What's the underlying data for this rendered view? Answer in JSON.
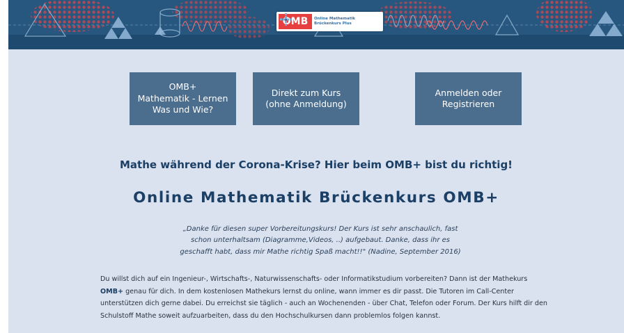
{
  "banner": {
    "logo_text": "OMB",
    "logo_sub1": "Online Mathematik",
    "logo_sub2": "Brückenkurs Plus"
  },
  "nav": {
    "buttons": [
      {
        "label": "OMB+\nMathematik - Lernen\nWas und Wie?"
      },
      {
        "label": "Direkt zum Kurs\n(ohne Anmeldung)"
      },
      {
        "label": "Anmelden oder\nRegistrieren"
      }
    ]
  },
  "main": {
    "headline": "Mathe während der Corona-Krise? Hier beim OMB+ bist du richtig!",
    "title": "Online Mathematik Brückenkurs OMB+",
    "quote": "„Danke für diesen super Vorbereitungskurs! Der Kurs ist sehr anschaulich, fast schon unterhaltsam (Diagramme,Videos, ..) aufgebaut. Danke, dass ihr es geschafft habt, dass mir Mathe richtig Spaß macht!!\" (Nadine, September 2016)",
    "intro_before": "Du willst dich auf ein Ingenieur-, Wirtschafts-, Naturwissenschafts- oder Informatikstudium vorbereiten? Dann ist der Mathekurs ",
    "intro_bold": "OMB+",
    "intro_after": " genau für dich. In dem kostenlosen Mathekurs lernst du online, wann immer es dir passt. Die Tutoren im Call-Center unterstützen dich gerne dabei. Du erreichst sie täglich - auch an Wochenenden - über Chat, Telefon oder Forum. Der Kurs hilft dir den Schulstoff Mathe soweit aufzuarbeiten, dass du den Hochschulkursen dann problemlos folgen kannst."
  },
  "colors": {
    "banner": "#27577f",
    "page_bg": "#d9e2ee",
    "button": "#4b6e8f",
    "heading": "#1c3f66",
    "logo_red": "#e53f3f"
  }
}
